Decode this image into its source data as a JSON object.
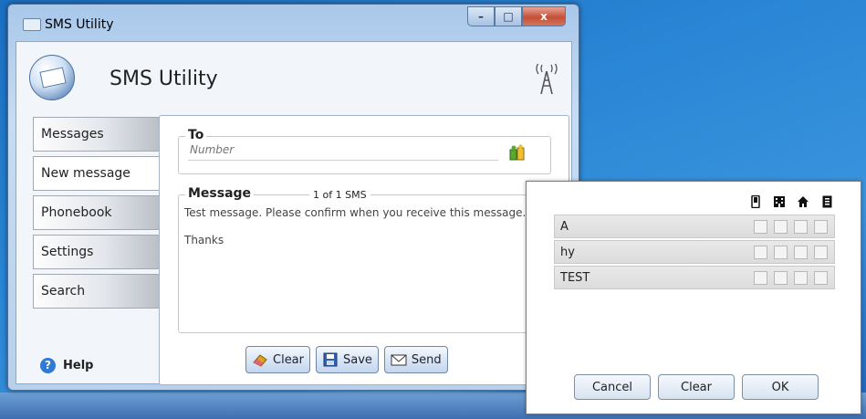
{
  "window": {
    "title": "SMS Utility",
    "minimize": "–",
    "maximize": "□",
    "close": "x"
  },
  "app": {
    "title": "SMS Utility"
  },
  "tabs": [
    {
      "label": "Messages"
    },
    {
      "label": "New message"
    },
    {
      "label": "Phonebook"
    },
    {
      "label": "Settings"
    },
    {
      "label": "Search"
    }
  ],
  "compose": {
    "to_label": "To",
    "number_placeholder": "Number",
    "message_label": "Message",
    "sms_count": "1 of 1 SMS",
    "message_text": "Test message. Please confirm when you receive this message.\n\nThanks"
  },
  "buttons": {
    "clear": "Clear",
    "save": "Save",
    "send": "Send"
  },
  "help": {
    "label": "Help"
  },
  "picker": {
    "contacts": [
      {
        "name": "A"
      },
      {
        "name": "hy"
      },
      {
        "name": "TEST"
      }
    ],
    "cancel": "Cancel",
    "clear": "Clear",
    "ok": "OK"
  }
}
